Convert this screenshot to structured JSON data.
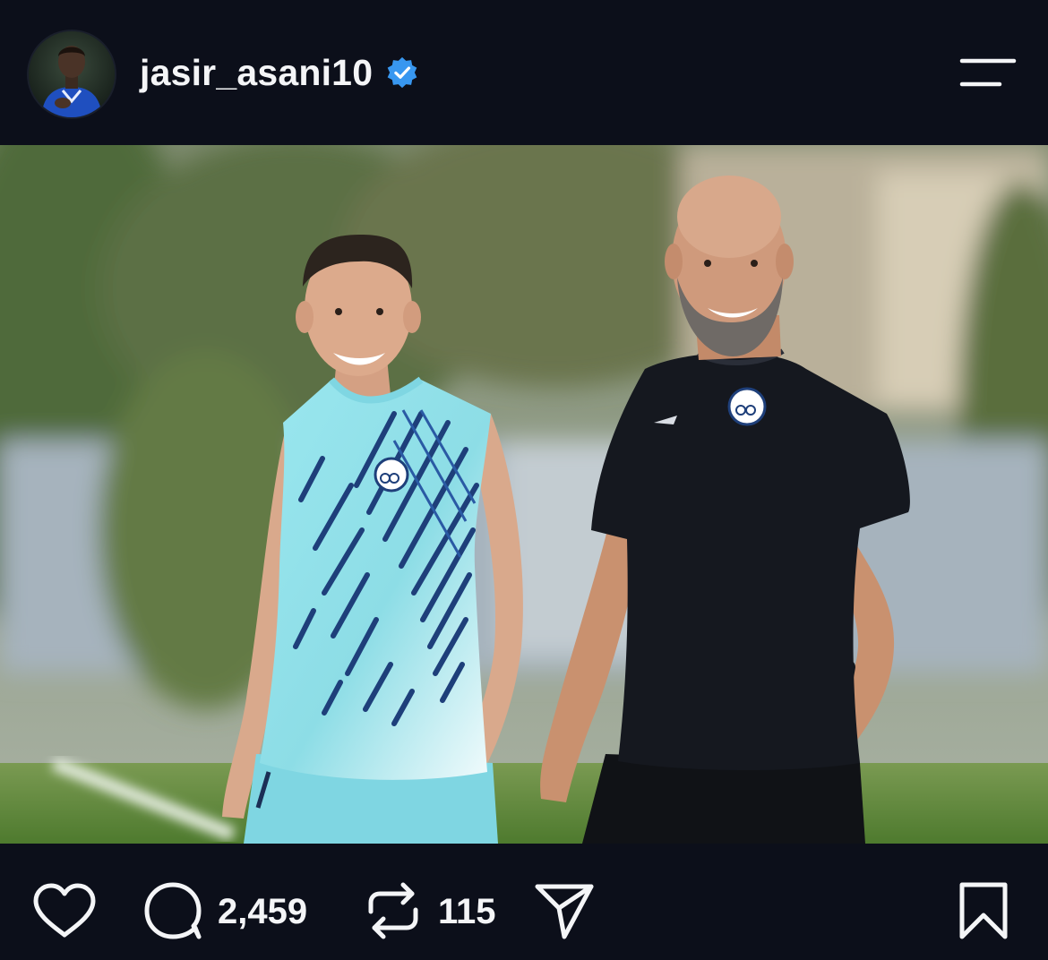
{
  "post": {
    "username": "jasir_asani10",
    "verified": true,
    "avatar_icon": "profile-avatar",
    "menu_icon": "menu-icon"
  },
  "actions": {
    "like_icon": "heart-icon",
    "comment_icon": "comment-icon",
    "comments_count": "2,459",
    "repost_icon": "repost-icon",
    "reposts_count": "115",
    "share_icon": "send-icon",
    "save_icon": "bookmark-icon"
  },
  "colors": {
    "background": "#0c0f1a",
    "text": "#f4f5f7",
    "verified_badge": "#3897f0",
    "jersey_cyan": "#8fe2ec",
    "jersey_navy": "#1e3f7a",
    "shirt_black": "#15181f"
  }
}
